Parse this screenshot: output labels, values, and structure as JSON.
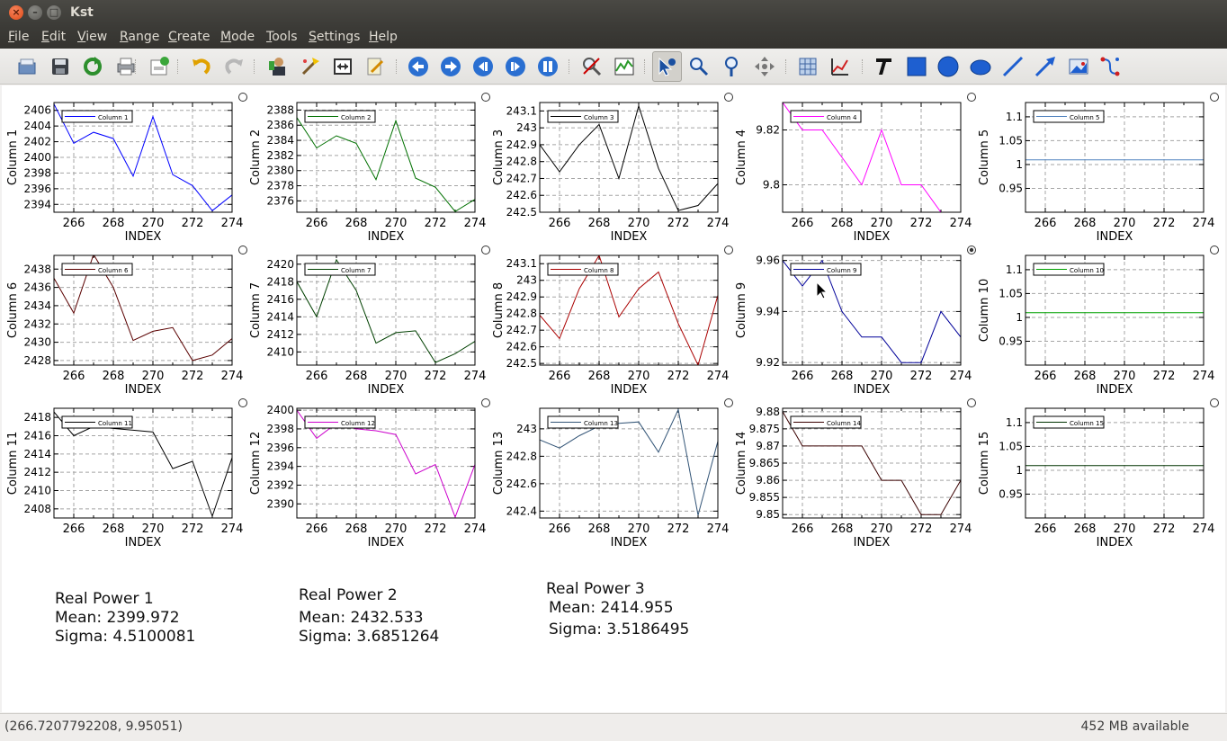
{
  "window": {
    "title": "Kst",
    "close_glyph": "×",
    "min_glyph": "–",
    "max_glyph": "□"
  },
  "menu": [
    {
      "mn": "F",
      "rest": "ile"
    },
    {
      "mn": "E",
      "rest": "dit"
    },
    {
      "mn": "V",
      "rest": "iew"
    },
    {
      "mn": "R",
      "rest": "ange"
    },
    {
      "mn": "C",
      "rest": "reate"
    },
    {
      "mn": "M",
      "rest": "ode"
    },
    {
      "mn": "T",
      "rest": "ools"
    },
    {
      "mn": "S",
      "rest": "ettings"
    },
    {
      "mn": "H",
      "rest": "elp"
    }
  ],
  "toolbar_icons": [
    "open-icon",
    "save-icon",
    "reload-icon",
    "print-icon",
    "log-icon",
    "undo-icon",
    "redo-icon",
    "data-manager-icon",
    "data-wizard-icon",
    "change-file-icon",
    "edit-icon",
    "back-icon",
    "forward-icon",
    "back-full-icon",
    "forward-full-icon",
    "pause-icon",
    "zoom-reset-icon",
    "zoom-fit-icon",
    "layout-mode-icon",
    "zoom-x-icon",
    "zoom-y-icon",
    "move-icon",
    "array-icon",
    "curve-icon",
    "text-icon",
    "box-icon",
    "circle-icon",
    "ellipse-icon",
    "line-icon",
    "arrow-icon",
    "picture-icon",
    "svg-icon"
  ],
  "colors": {
    "grid": "#a5a5a5"
  },
  "chart_data": [
    {
      "type": "line",
      "ylabel": "Column 1",
      "xlabel": "INDEX",
      "legend": "Column 1",
      "color": "#0000ff",
      "x": [
        265,
        266,
        267,
        268,
        269,
        270,
        271,
        272,
        273,
        274
      ],
      "y": [
        2406.8,
        2401.8,
        2403.2,
        2402.4,
        2397.6,
        2405.2,
        2397.8,
        2396.4,
        2393.2,
        2395.2
      ],
      "ylim": [
        2393,
        2407
      ],
      "yticks": [
        2394,
        2396,
        2398,
        2400,
        2402,
        2404,
        2406
      ],
      "xticks": [
        266,
        268,
        270,
        272,
        274
      ]
    },
    {
      "type": "line",
      "ylabel": "Column 2",
      "xlabel": "INDEX",
      "legend": "Column 2",
      "color": "#007000",
      "x": [
        265,
        266,
        267,
        268,
        269,
        270,
        271,
        272,
        273,
        274
      ],
      "y": [
        2387,
        2383,
        2384.6,
        2383.6,
        2378.8,
        2386.6,
        2379,
        2377.8,
        2374.6,
        2376.2
      ],
      "ylim": [
        2374.5,
        2389
      ],
      "yticks": [
        2376,
        2378,
        2380,
        2382,
        2384,
        2386,
        2388
      ],
      "xticks": [
        266,
        268,
        270,
        272,
        274
      ]
    },
    {
      "type": "line",
      "ylabel": "Column 3",
      "xlabel": "INDEX",
      "legend": "Column 3",
      "color": "#000000",
      "x": [
        265,
        266,
        267,
        268,
        269,
        270,
        271,
        272,
        273,
        274
      ],
      "y": [
        242.9,
        242.74,
        242.9,
        243.02,
        242.7,
        243.13,
        242.76,
        242.51,
        242.54,
        242.67
      ],
      "ylim": [
        242.5,
        243.15
      ],
      "yticks": [
        242.5,
        242.6,
        242.7,
        242.8,
        242.9,
        243,
        243.1
      ],
      "xticks": [
        266,
        268,
        270,
        272,
        274
      ]
    },
    {
      "type": "line",
      "ylabel": "Column 4",
      "xlabel": "INDEX",
      "legend": "Column 4",
      "color": "#ff00ff",
      "x": [
        265,
        266,
        267,
        268,
        269,
        270,
        271,
        272,
        273,
        274
      ],
      "y": [
        9.83,
        9.82,
        9.82,
        9.81,
        9.8,
        9.82,
        9.8,
        9.8,
        9.79,
        9.79
      ],
      "ylim": [
        9.79,
        9.83
      ],
      "yticks": [
        9.8,
        9.82
      ],
      "xticks": [
        266,
        268,
        270,
        272,
        274
      ]
    },
    {
      "type": "line",
      "ylabel": "Column 5",
      "xlabel": "INDEX",
      "legend": "Column 5",
      "color": "#4f81bd",
      "x": [
        265,
        274
      ],
      "y": [
        1.01,
        1.01
      ],
      "ylim": [
        0.9,
        1.13
      ],
      "yticks": [
        0.95,
        1,
        1.05,
        1.1
      ],
      "xticks": [
        266,
        268,
        270,
        272,
        274
      ]
    },
    {
      "type": "line",
      "ylabel": "Column 6",
      "xlabel": "INDEX",
      "legend": "Column 6",
      "color": "#5a0000",
      "x": [
        265,
        266,
        267,
        268,
        269,
        270,
        271,
        272,
        273,
        274
      ],
      "y": [
        2437,
        2433.2,
        2439.6,
        2436,
        2430.2,
        2431.2,
        2431.6,
        2428,
        2428.6,
        2430.4
      ],
      "ylim": [
        2427.5,
        2439.5
      ],
      "yticks": [
        2428,
        2430,
        2432,
        2434,
        2436,
        2438
      ],
      "xticks": [
        266,
        268,
        270,
        272,
        274
      ]
    },
    {
      "type": "line",
      "ylabel": "Column 7",
      "xlabel": "INDEX",
      "legend": "Column 7",
      "color": "#004000",
      "x": [
        265,
        266,
        267,
        268,
        269,
        270,
        271,
        272,
        273,
        274
      ],
      "y": [
        2418,
        2414,
        2420.5,
        2417,
        2411,
        2412.2,
        2412.4,
        2408.8,
        2409.8,
        2411.2
      ],
      "ylim": [
        2408.5,
        2421
      ],
      "yticks": [
        2410,
        2412,
        2414,
        2416,
        2418,
        2420
      ],
      "xticks": [
        266,
        268,
        270,
        272,
        274
      ]
    },
    {
      "type": "line",
      "ylabel": "Column 8",
      "xlabel": "INDEX",
      "legend": "Column 8",
      "color": "#aa0000",
      "x": [
        265,
        266,
        267,
        268,
        269,
        270,
        271,
        272,
        273,
        274
      ],
      "y": [
        242.79,
        242.65,
        242.95,
        243.15,
        242.78,
        242.95,
        243.05,
        242.74,
        242.49,
        242.91
      ],
      "ylim": [
        242.49,
        243.15
      ],
      "yticks": [
        242.5,
        242.6,
        242.7,
        242.8,
        242.9,
        243,
        243.1
      ],
      "xticks": [
        266,
        268,
        270,
        272,
        274
      ]
    },
    {
      "type": "line",
      "ylabel": "Column 9",
      "xlabel": "INDEX",
      "legend": "Column 9",
      "color": "#000099",
      "x": [
        265,
        266,
        267,
        268,
        269,
        270,
        271,
        272,
        273,
        274
      ],
      "y": [
        9.96,
        9.95,
        9.96,
        9.94,
        9.93,
        9.93,
        9.92,
        9.92,
        9.94,
        9.93
      ],
      "ylim": [
        9.919,
        9.962
      ],
      "yticks": [
        9.92,
        9.94,
        9.96
      ],
      "xticks": [
        266,
        268,
        270,
        272,
        274
      ]
    },
    {
      "type": "line",
      "ylabel": "Column 10",
      "xlabel": "INDEX",
      "legend": "Column 10",
      "color": "#00a000",
      "x": [
        265,
        274
      ],
      "y": [
        1.01,
        1.01
      ],
      "ylim": [
        0.9,
        1.13
      ],
      "yticks": [
        0.95,
        1,
        1.05,
        1.1
      ],
      "xticks": [
        266,
        268,
        270,
        272,
        274
      ]
    },
    {
      "type": "line",
      "ylabel": "Column 11",
      "xlabel": "INDEX",
      "legend": "Column 11",
      "color": "#000000",
      "x": [
        265,
        266,
        267,
        268,
        269,
        270,
        271,
        272,
        273,
        274
      ],
      "y": [
        2418.6,
        2416,
        2417,
        2416.8,
        2416.6,
        2416.4,
        2412.4,
        2413.2,
        2407.2,
        2413.6
      ],
      "ylim": [
        2407,
        2419
      ],
      "yticks": [
        2408,
        2410,
        2412,
        2414,
        2416,
        2418
      ],
      "xticks": [
        266,
        268,
        270,
        272,
        274
      ]
    },
    {
      "type": "line",
      "ylabel": "Column 12",
      "xlabel": "INDEX",
      "legend": "Column 12",
      "color": "#cc00cc",
      "x": [
        265,
        266,
        267,
        268,
        269,
        270,
        271,
        272,
        273,
        274
      ],
      "y": [
        2400,
        2397,
        2398.6,
        2398,
        2397.8,
        2397.4,
        2393.2,
        2394.2,
        2388.6,
        2394.2
      ],
      "ylim": [
        2388.5,
        2400.2
      ],
      "yticks": [
        2390,
        2392,
        2394,
        2396,
        2398,
        2400
      ],
      "xticks": [
        266,
        268,
        270,
        272,
        274
      ]
    },
    {
      "type": "line",
      "ylabel": "Column 13",
      "xlabel": "INDEX",
      "legend": "Column 13",
      "color": "#335577",
      "x": [
        265,
        266,
        267,
        268,
        269,
        270,
        271,
        272,
        273,
        274
      ],
      "y": [
        242.92,
        242.86,
        242.95,
        243.02,
        243.04,
        243.05,
        242.83,
        243.14,
        242.37,
        242.91
      ],
      "ylim": [
        242.35,
        243.15
      ],
      "yticks": [
        242.4,
        242.6,
        242.8,
        243
      ],
      "xticks": [
        266,
        268,
        270,
        272,
        274
      ]
    },
    {
      "type": "line",
      "ylabel": "Column 14",
      "xlabel": "INDEX",
      "legend": "Column 14",
      "color": "#3a0000",
      "x": [
        265,
        266,
        267,
        268,
        269,
        270,
        271,
        272,
        273,
        274
      ],
      "y": [
        9.88,
        9.87,
        9.87,
        9.87,
        9.87,
        9.86,
        9.86,
        9.85,
        9.85,
        9.86
      ],
      "ylim": [
        9.849,
        9.881
      ],
      "yticks": [
        9.85,
        9.855,
        9.86,
        9.865,
        9.87,
        9.875,
        9.88
      ],
      "xticks": [
        266,
        268,
        270,
        272,
        274
      ]
    },
    {
      "type": "line",
      "ylabel": "Column 15",
      "xlabel": "INDEX",
      "legend": "Column 15",
      "color": "#003300",
      "x": [
        265,
        274
      ],
      "y": [
        1.01,
        1.01
      ],
      "ylim": [
        0.9,
        1.13
      ],
      "yticks": [
        0.95,
        1,
        1.05,
        1.1
      ],
      "xticks": [
        266,
        268,
        270,
        272,
        274
      ]
    }
  ],
  "stats": [
    {
      "title": "Real Power 1",
      "mean": "Mean: 2399.972",
      "sigma": "Sigma: 4.5100081"
    },
    {
      "title": "Real Power 2",
      "mean": "Mean: 2432.533",
      "sigma": "Sigma: 3.6851264"
    },
    {
      "title": "Real Power 3",
      "mean": "Mean: 2414.955",
      "sigma": "Sigma: 3.5186495"
    }
  ],
  "status": {
    "coords": "(266.7207792208, 9.95051)",
    "memory": "452 MB available"
  }
}
